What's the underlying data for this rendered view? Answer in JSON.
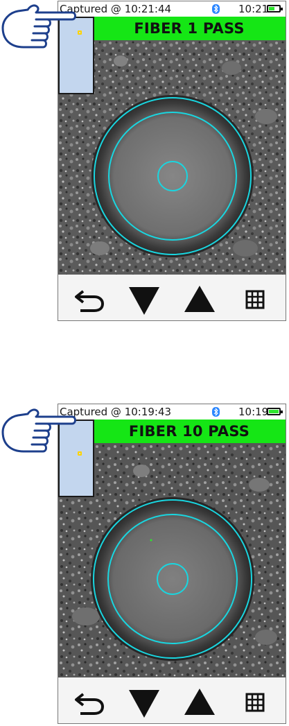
{
  "panels": [
    {
      "status": {
        "captured": "Captured @ 10:21:44",
        "clock": "10:21",
        "battery_level": 0.55
      },
      "banner": {
        "text": "FIBER 1 PASS",
        "color": "#15e615"
      }
    },
    {
      "status": {
        "captured": "Captured @ 10:19:43",
        "clock": "10:19",
        "battery_level": 1.0
      },
      "banner": {
        "text": "FIBER 10 PASS",
        "color": "#15e615"
      }
    }
  ],
  "icons": {
    "pointer": "pointing-hand-icon",
    "bluetooth": "bluetooth-icon",
    "battery": "battery-icon",
    "back": "back-arrow-icon",
    "down": "triangle-down-icon",
    "up": "triangle-up-icon",
    "grid": "grid-icon"
  },
  "colors": {
    "pass_banner": "#15e615",
    "zone_circles": "#19d6e0",
    "thumbnail": "#c3d6ee",
    "hand_outline": "#1d3f8c",
    "bluetooth": "#2a86ff"
  }
}
